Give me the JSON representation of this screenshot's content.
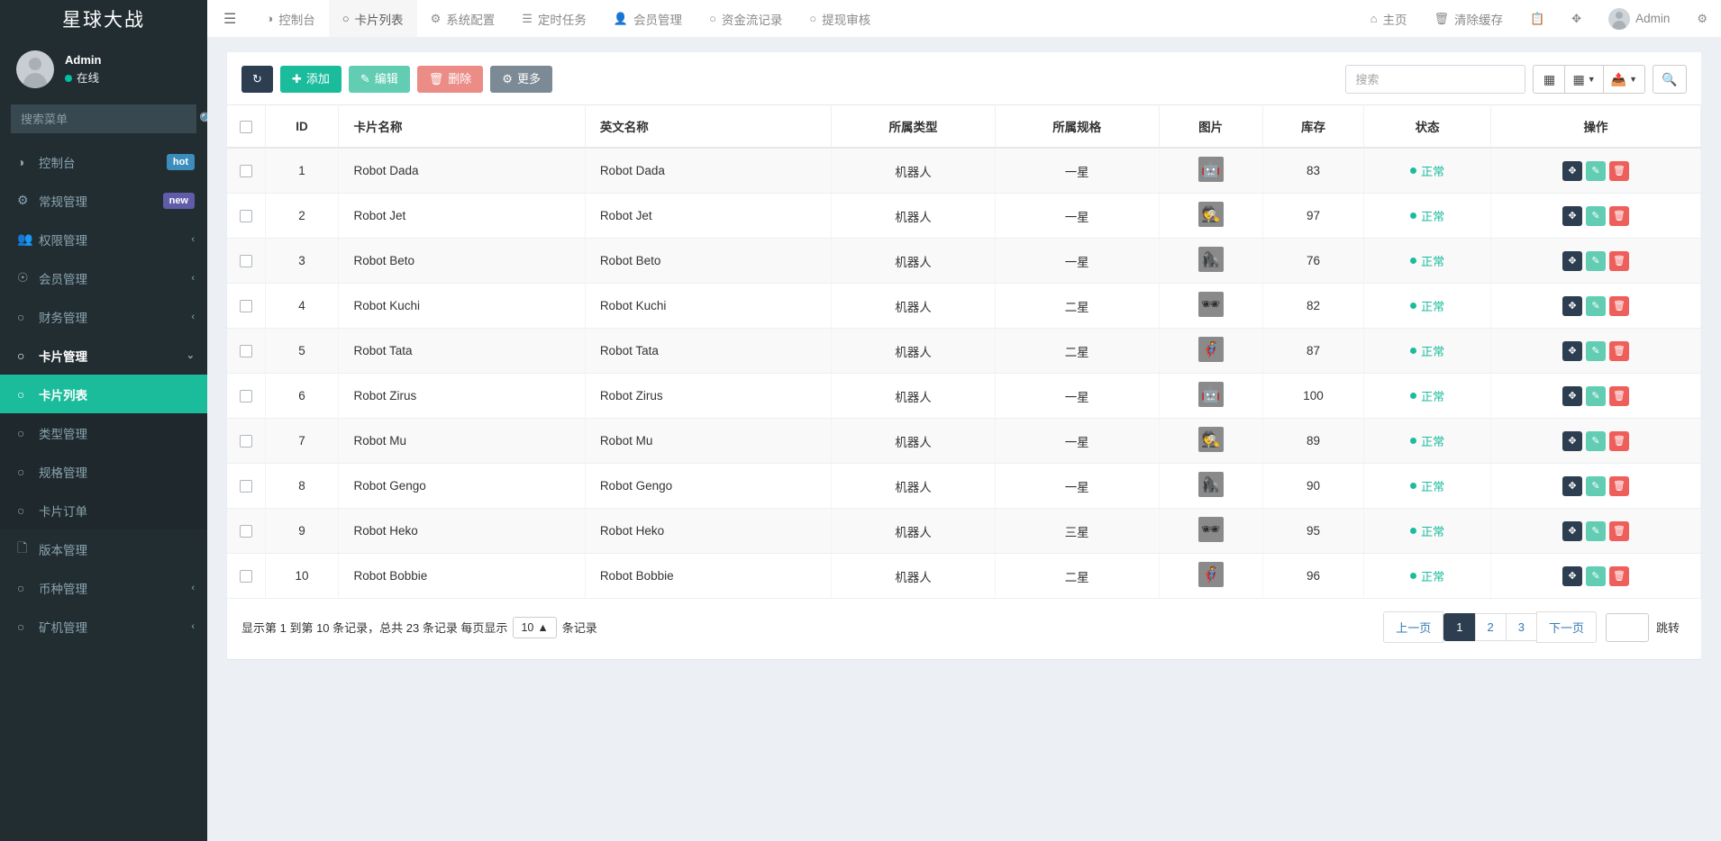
{
  "sidebar": {
    "brand": "星球大战",
    "user": {
      "name": "Admin",
      "status": "在线"
    },
    "search_placeholder": "搜索菜单",
    "items": [
      {
        "label": "控制台",
        "icon": "dashboard-icon",
        "badge": "hot",
        "badge_type": "hot"
      },
      {
        "label": "常规管理",
        "icon": "gears-icon",
        "badge": "new",
        "badge_type": "new"
      },
      {
        "label": "权限管理",
        "icon": "users-icon",
        "caret": "‹"
      },
      {
        "label": "会员管理",
        "icon": "user-circle-icon",
        "caret": "‹"
      },
      {
        "label": "财务管理",
        "icon": "circle-icon",
        "caret": "‹"
      },
      {
        "label": "卡片管理",
        "icon": "circle-icon",
        "caret": "⌄",
        "active_parent": true
      },
      {
        "label": "卡片列表",
        "icon": "circle-icon",
        "sub": true,
        "selected": true
      },
      {
        "label": "类型管理",
        "icon": "circle-o-icon",
        "sub": true
      },
      {
        "label": "规格管理",
        "icon": "circle-o-icon",
        "sub": true
      },
      {
        "label": "卡片订单",
        "icon": "circle-o-icon",
        "sub": true
      },
      {
        "label": "版本管理",
        "icon": "file-icon"
      },
      {
        "label": "币种管理",
        "icon": "circle-icon",
        "caret": "‹"
      },
      {
        "label": "矿机管理",
        "icon": "circle-icon",
        "caret": "‹"
      }
    ]
  },
  "topnav": {
    "hamburger": "☰",
    "left_items": [
      {
        "label": "控制台",
        "icon": "dashboard-icon"
      },
      {
        "label": "卡片列表",
        "icon": "circle-icon",
        "active": true
      },
      {
        "label": "系统配置",
        "icon": "gear-icon"
      },
      {
        "label": "定时任务",
        "icon": "tasks-icon"
      },
      {
        "label": "会员管理",
        "icon": "user-icon"
      },
      {
        "label": "资金流记录",
        "icon": "circle-icon"
      },
      {
        "label": "提现审核",
        "icon": "circle-icon"
      }
    ],
    "right_items": [
      {
        "label": "主页",
        "icon": "home-icon"
      },
      {
        "label": "清除缓存",
        "icon": "trash-icon"
      },
      {
        "label": "",
        "icon": "copy-icon"
      },
      {
        "label": "",
        "icon": "fullscreen-icon"
      },
      {
        "label": "Admin",
        "icon": "avatar-icon"
      },
      {
        "label": "",
        "icon": "gears-icon"
      }
    ]
  },
  "toolbar": {
    "refresh_label": "",
    "add_label": "添加",
    "edit_label": "编辑",
    "delete_label": "删除",
    "more_label": "更多",
    "search_placeholder": "搜索",
    "icon_list": "list-icon",
    "icon_columns": "columns-icon",
    "icon_export": "export-icon",
    "icon_search": "search-icon"
  },
  "table": {
    "columns": [
      "",
      "ID",
      "卡片名称",
      "英文名称",
      "所属类型",
      "所属规格",
      "图片",
      "库存",
      "状态",
      "操作"
    ],
    "rows": [
      {
        "id": "1",
        "name": "Robot Dada",
        "en": "Robot Dada",
        "type": "机器人",
        "spec": "一星",
        "stock": "83",
        "status": "正常"
      },
      {
        "id": "2",
        "name": "Robot Jet",
        "en": "Robot Jet",
        "type": "机器人",
        "spec": "一星",
        "stock": "97",
        "status": "正常"
      },
      {
        "id": "3",
        "name": "Robot Beto",
        "en": "Robot Beto",
        "type": "机器人",
        "spec": "一星",
        "stock": "76",
        "status": "正常"
      },
      {
        "id": "4",
        "name": "Robot Kuchi",
        "en": "Robot Kuchi",
        "type": "机器人",
        "spec": "二星",
        "stock": "82",
        "status": "正常"
      },
      {
        "id": "5",
        "name": "Robot Tata",
        "en": "Robot Tata",
        "type": "机器人",
        "spec": "二星",
        "stock": "87",
        "status": "正常"
      },
      {
        "id": "6",
        "name": "Robot Zirus",
        "en": "Robot Zirus",
        "type": "机器人",
        "spec": "一星",
        "stock": "100",
        "status": "正常"
      },
      {
        "id": "7",
        "name": "Robot Mu",
        "en": "Robot Mu",
        "type": "机器人",
        "spec": "一星",
        "stock": "89",
        "status": "正常"
      },
      {
        "id": "8",
        "name": "Robot Gengo",
        "en": "Robot Gengo",
        "type": "机器人",
        "spec": "一星",
        "stock": "90",
        "status": "正常"
      },
      {
        "id": "9",
        "name": "Robot Heko",
        "en": "Robot Heko",
        "type": "机器人",
        "spec": "三星",
        "stock": "95",
        "status": "正常"
      },
      {
        "id": "10",
        "name": "Robot Bobbie",
        "en": "Robot Bobbie",
        "type": "机器人",
        "spec": "二星",
        "stock": "96",
        "status": "正常"
      }
    ]
  },
  "footer": {
    "info_prefix": "显示第 1 到第 10 条记录，总共 23 条记录 每页显示",
    "page_size": "10",
    "info_suffix": "条记录",
    "prev": "上一页",
    "pages": [
      "1",
      "2",
      "3"
    ],
    "current_page": "1",
    "next": "下一页",
    "jump_label": "跳转",
    "jump_value": ""
  },
  "colors": {
    "accent": "#1abc9c",
    "sidebar_bg": "#222d32",
    "danger": "#ee5f5b",
    "dark": "#2c3e50"
  }
}
